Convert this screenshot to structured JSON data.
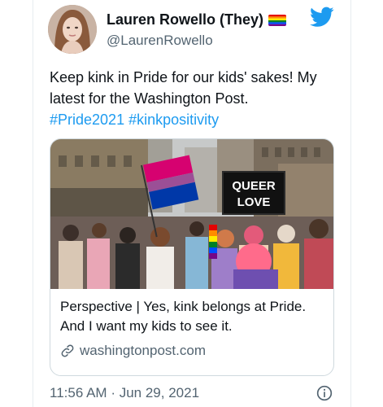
{
  "author": {
    "display_name": "Lauren Rowello (They)",
    "handle": "@LaurenRowello",
    "badge_icon": "pride-flag-icon"
  },
  "tweet": {
    "text": "Keep kink in Pride for our kids' sakes! My latest for the Washington Post.",
    "hashtags": "#Pride2021 #kinkpositivity"
  },
  "link_card": {
    "image_sign_text": "QUEER LOVE",
    "title": "Perspective | Yes, kink belongs at Pride. And I want my kids to see it.",
    "domain": "washingtonpost.com"
  },
  "meta": {
    "time": "11:56 AM",
    "separator": "·",
    "date": "Jun 29, 2021"
  },
  "colors": {
    "accent": "#1d9bf0",
    "text": "#0f1419",
    "secondary": "#536471",
    "border": "#cfd9de"
  }
}
